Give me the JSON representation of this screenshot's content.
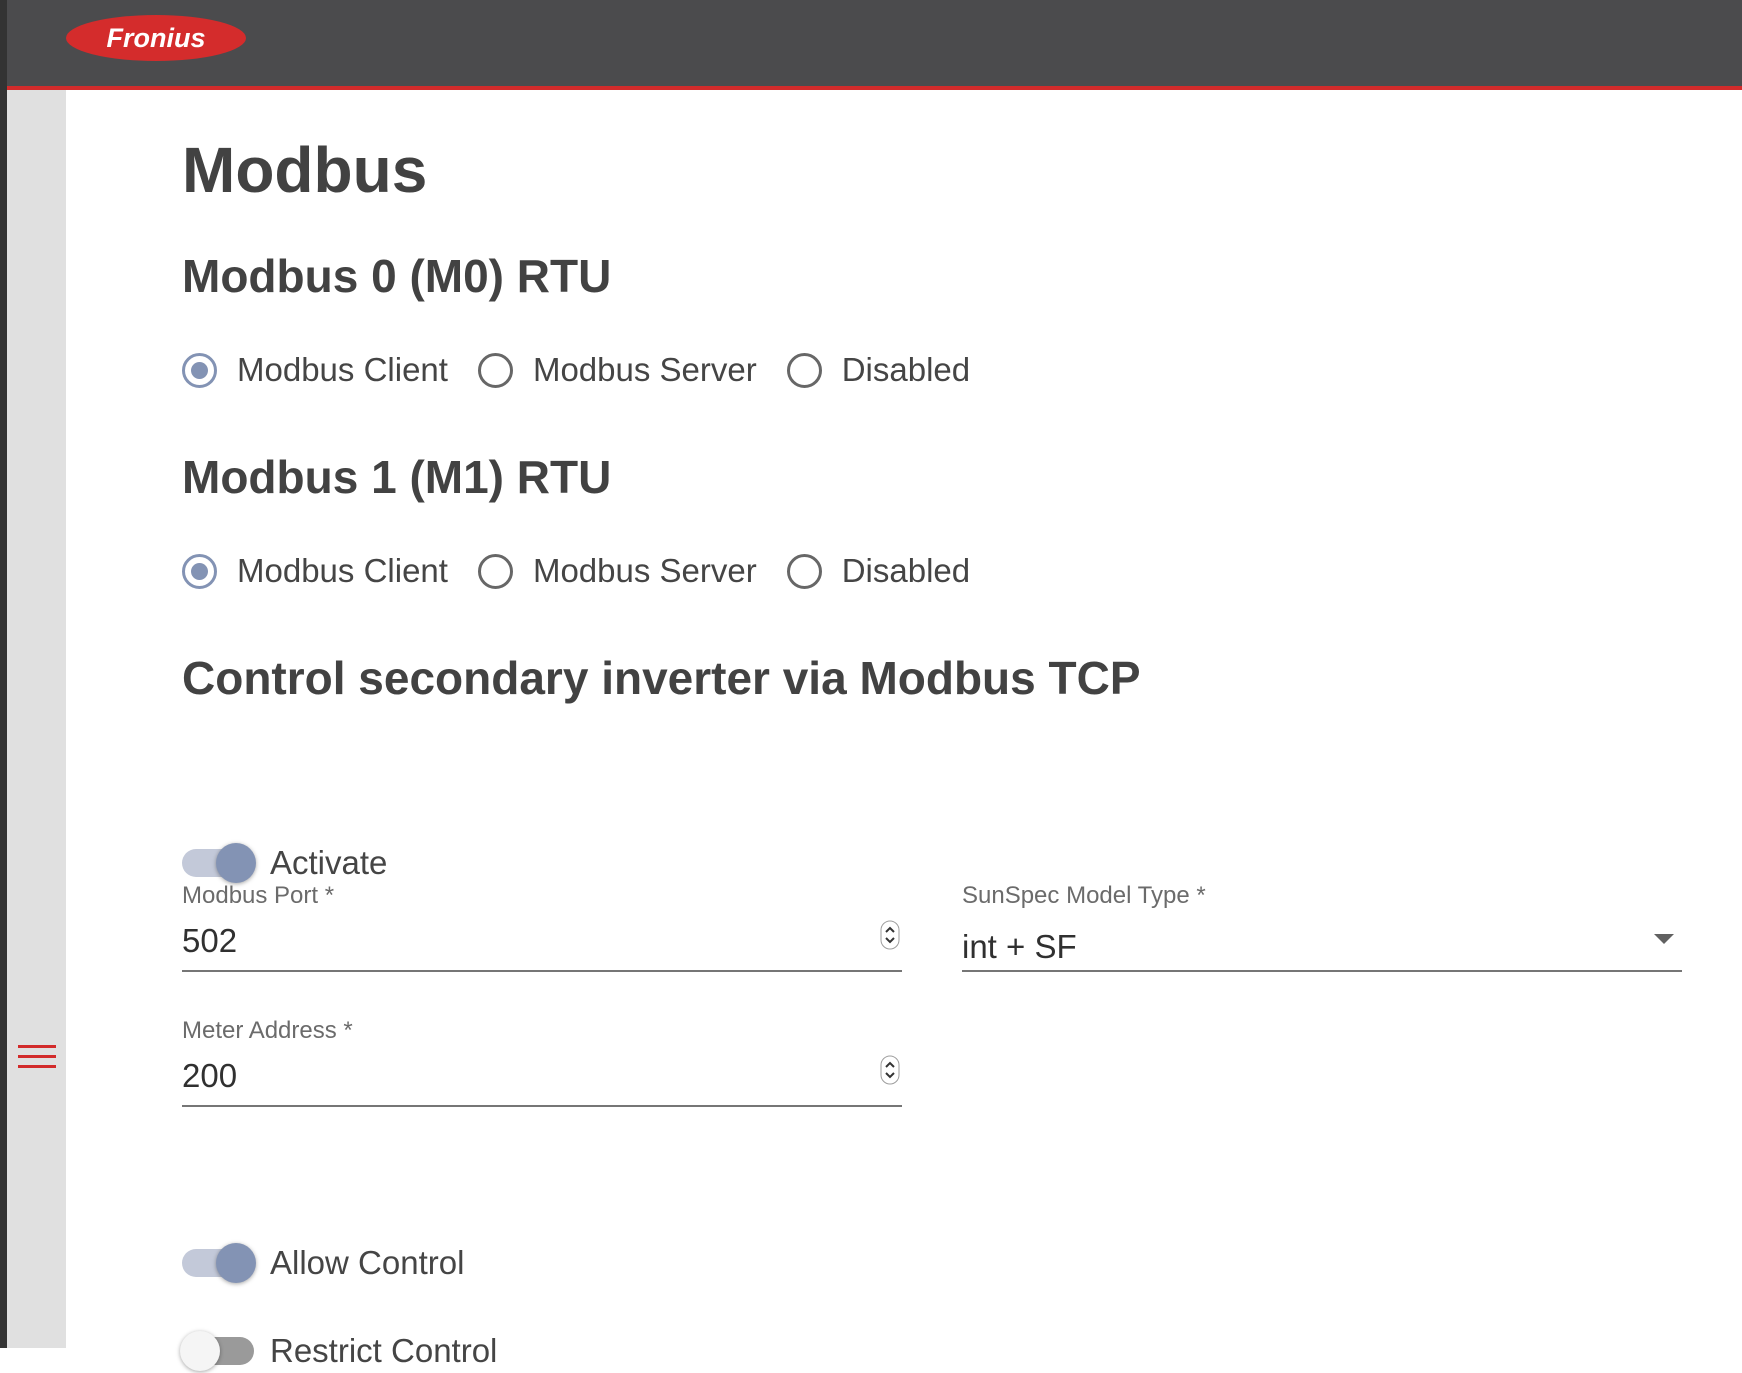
{
  "header": {
    "logo_text": "Fronius",
    "brand_color": "#d22b2b"
  },
  "page": {
    "title": "Modbus"
  },
  "modbus0": {
    "title": "Modbus 0 (M0) RTU",
    "options": [
      "Modbus Client",
      "Modbus Server",
      "Disabled"
    ],
    "selected": "Modbus Client"
  },
  "modbus1": {
    "title": "Modbus 1 (M1) RTU",
    "options": [
      "Modbus Client",
      "Modbus Server",
      "Disabled"
    ],
    "selected": "Modbus Client"
  },
  "tcp": {
    "title": "Control secondary inverter via Modbus TCP",
    "activate": {
      "label": "Activate",
      "on": true
    },
    "port": {
      "label": "Modbus Port *",
      "value": "502"
    },
    "sunspec": {
      "label": "SunSpec Model Type *",
      "value": "int + SF"
    },
    "meter": {
      "label": "Meter Address *",
      "value": "200"
    },
    "allow_control": {
      "label": "Allow Control",
      "on": true
    },
    "restrict_control": {
      "label": "Restrict Control",
      "on": false
    }
  },
  "sidebar": {
    "menu_icon": "hamburger-menu-icon"
  },
  "colors": {
    "accent": "#8393b4",
    "topbar": "#4b4b4d",
    "sidebar": "#e0e0e0"
  }
}
